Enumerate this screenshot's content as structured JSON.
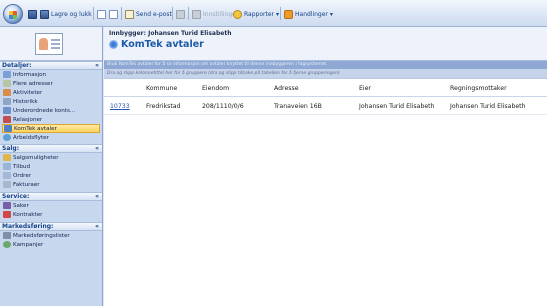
{
  "toolbar": {
    "save_close_label": "Lagre og lukk",
    "send_email_label": "Send e-post",
    "disabled_label": "Innstillinger",
    "reports_label": "Rapporter",
    "actions_label": "Handlinger"
  },
  "sidebar": {
    "groups": [
      {
        "title": "Detaljer:",
        "items": [
          {
            "label": "Informasjon",
            "icon": "info-icon"
          },
          {
            "label": "Flere adresser",
            "icon": "map-icon"
          },
          {
            "label": "Aktiviteter",
            "icon": "activities-icon"
          },
          {
            "label": "Historikk",
            "icon": "history-icon"
          },
          {
            "label": "Underordnede konts...",
            "icon": "subaccounts-icon"
          },
          {
            "label": "Relasjoner",
            "icon": "relations-icon"
          },
          {
            "label": "KomTek avtaler",
            "icon": "komtek-icon",
            "selected": true
          },
          {
            "label": "Arbeidsflyter",
            "icon": "workflow-icon"
          }
        ]
      },
      {
        "title": "Salg:",
        "items": [
          {
            "label": "Salgsmuligheter",
            "icon": "opportunity-icon"
          },
          {
            "label": "Tilbud",
            "icon": "quote-icon"
          },
          {
            "label": "Ordrer",
            "icon": "order-icon"
          },
          {
            "label": "Fakturaer",
            "icon": "invoice-icon"
          }
        ]
      },
      {
        "title": "Service:",
        "items": [
          {
            "label": "Saker",
            "icon": "case-icon"
          },
          {
            "label": "Kontrakter",
            "icon": "contract-icon"
          }
        ]
      },
      {
        "title": "Markedsføring:",
        "items": [
          {
            "label": "Markedsføringslister",
            "icon": "marketing-list-icon"
          },
          {
            "label": "Kampanjer",
            "icon": "campaign-icon"
          }
        ]
      }
    ]
  },
  "main": {
    "subtitle": "Innbygger: Johansen Turid Elisabeth",
    "title": "KomTek avtaler",
    "info_bar": "Bruk KomTek avtaler for å se informasjon om avtaler knyttet til denne innbyggeren i fagsystemet.",
    "filter_bar": "Dra og slipp kolonnetittel her for å gruppere (dra og slipp tilbake på tabellen for å fjerne grupperingen)",
    "columns": [
      "Kommune",
      "Eiendom",
      "Adresse",
      "Eier",
      "Regningsmottaker"
    ],
    "rows": [
      {
        "id": "10733",
        "kommune": "Fredrikstad",
        "eiendom": "208/1110/0/6",
        "adresse": "Tranaveien 16B",
        "eier": "Johansen Turid Elisabeth",
        "regningsmottaker": "Johansen Turid Elisabeth"
      }
    ]
  }
}
